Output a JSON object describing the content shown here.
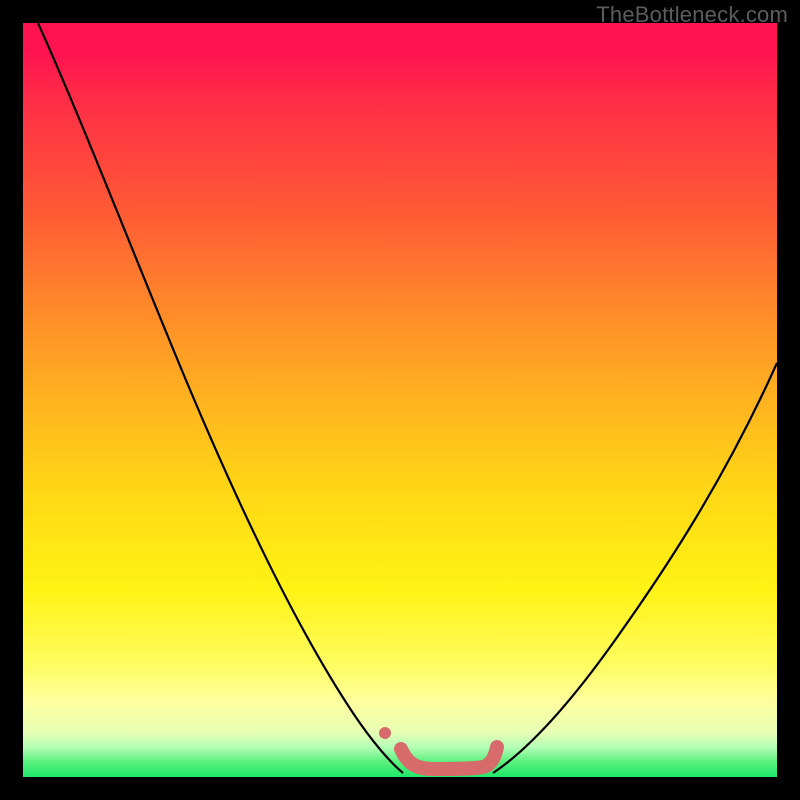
{
  "watermark": "TheBottleneck.com",
  "chart_data": {
    "type": "line",
    "title": "",
    "xlabel": "",
    "ylabel": "",
    "xlim": [
      0,
      100
    ],
    "ylim": [
      0,
      100
    ],
    "grid": false,
    "background_gradient": {
      "direction": "vertical",
      "stops": [
        {
          "pos": 0,
          "color": "#ff1450"
        },
        {
          "pos": 25,
          "color": "#ff5a35"
        },
        {
          "pos": 50,
          "color": "#ffb31f"
        },
        {
          "pos": 75,
          "color": "#fff314"
        },
        {
          "pos": 90,
          "color": "#fdff9e"
        },
        {
          "pos": 100,
          "color": "#1fe86a"
        }
      ]
    },
    "series": [
      {
        "name": "left-curve",
        "color": "#000000",
        "stroke_width": 2,
        "x": [
          2,
          10,
          18,
          26,
          34,
          42,
          48,
          50
        ],
        "y": [
          100,
          82,
          64,
          46,
          28,
          11,
          2,
          0
        ]
      },
      {
        "name": "right-curve",
        "color": "#000000",
        "stroke_width": 2,
        "x": [
          62,
          68,
          76,
          84,
          92,
          100
        ],
        "y": [
          0,
          6,
          16,
          28,
          41,
          55
        ]
      },
      {
        "name": "bottom-flat-marker",
        "color": "#d76b6b",
        "stroke_width": 10,
        "linecap": "round",
        "x": [
          50,
          52,
          56,
          60,
          62
        ],
        "y": [
          4,
          1,
          1,
          1,
          4
        ]
      },
      {
        "name": "left-dot-marker",
        "color": "#d76b6b",
        "type_hint": "point",
        "x": [
          48
        ],
        "y": [
          6
        ]
      }
    ]
  }
}
